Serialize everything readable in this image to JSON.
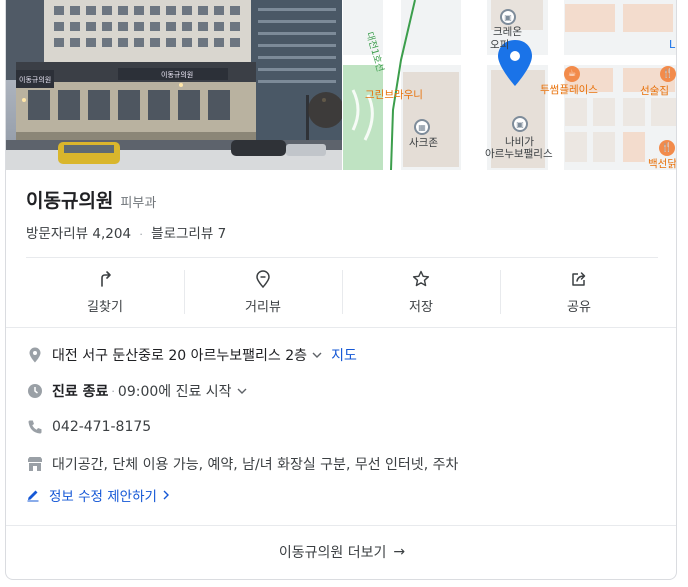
{
  "place": {
    "name": "이동규의원",
    "category": "피부과",
    "visitor_reviews_label": "방문자리뷰",
    "visitor_reviews_count": "4,204",
    "blog_reviews_label": "블로그리뷰",
    "blog_reviews_count": "7"
  },
  "photo": {
    "sign_left": "이동규의원",
    "sign_main": "이동규의원"
  },
  "map": {
    "labels": {
      "road": "대전1호선",
      "cremeon": "크레온",
      "cremeon2": "오피",
      "greenbrownie": "그린브라우니",
      "twosome": "투썸플레이스",
      "sakzon": "사크존",
      "nabiga": "나비가",
      "artnouveau": "아르누보팰리스",
      "seonsul": "선술집",
      "baekseon": "백선닭꼬",
      "edge_l": "L"
    },
    "colors": {
      "pin": "#1a73e8",
      "road": "#3c9e4c",
      "park": "#bfe3c2"
    }
  },
  "actions": [
    {
      "label": "길찾기",
      "icon": "directions-icon"
    },
    {
      "label": "거리뷰",
      "icon": "streetview-icon"
    },
    {
      "label": "저장",
      "icon": "star-icon"
    },
    {
      "label": "공유",
      "icon": "share-icon"
    }
  ],
  "info": {
    "address": "대전 서구 둔산중로 20 아르누보팰리스 2층",
    "map_link": "지도",
    "hours_status": "진료 종료",
    "hours_next": "09:00에 진료 시작",
    "phone": "042-471-8175",
    "amenities": "대기공간, 단체 이용 가능, 예약, 남/녀 화장실 구분, 무선 인터넷, 주차",
    "edit_suggest": "정보 수정 제안하기"
  },
  "more": {
    "label": "이동규의원 더보기"
  }
}
